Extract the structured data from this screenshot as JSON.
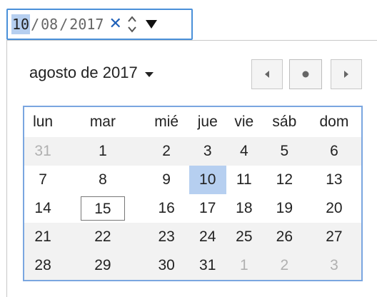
{
  "date_input": {
    "day": "10",
    "month": "08",
    "year": "2017",
    "separator": "/"
  },
  "icons": {
    "clear": "close-icon",
    "spin": "spinner-icon",
    "dropdown": "triangle-down-icon"
  },
  "picker": {
    "month_label": "agosto de 2017",
    "weekdays": [
      "lun",
      "mar",
      "mié",
      "jue",
      "vie",
      "sáb",
      "dom"
    ],
    "weeks": [
      [
        {
          "d": "31",
          "other": true
        },
        {
          "d": "1"
        },
        {
          "d": "2"
        },
        {
          "d": "3"
        },
        {
          "d": "4"
        },
        {
          "d": "5"
        },
        {
          "d": "6"
        }
      ],
      [
        {
          "d": "7"
        },
        {
          "d": "8"
        },
        {
          "d": "9"
        },
        {
          "d": "10",
          "selected": true
        },
        {
          "d": "11"
        },
        {
          "d": "12"
        },
        {
          "d": "13"
        }
      ],
      [
        {
          "d": "14"
        },
        {
          "d": "15",
          "today": true
        },
        {
          "d": "16"
        },
        {
          "d": "17"
        },
        {
          "d": "18"
        },
        {
          "d": "19"
        },
        {
          "d": "20"
        }
      ],
      [
        {
          "d": "21"
        },
        {
          "d": "22"
        },
        {
          "d": "23"
        },
        {
          "d": "24"
        },
        {
          "d": "25"
        },
        {
          "d": "26"
        },
        {
          "d": "27"
        }
      ],
      [
        {
          "d": "28"
        },
        {
          "d": "29"
        },
        {
          "d": "30"
        },
        {
          "d": "31"
        },
        {
          "d": "1",
          "other": true
        },
        {
          "d": "2",
          "other": true
        },
        {
          "d": "3",
          "other": true
        }
      ]
    ]
  },
  "colors": {
    "accent_border": "#4a90d9",
    "selection": "#b6cff0",
    "other_month_text": "#b0b0b0"
  }
}
